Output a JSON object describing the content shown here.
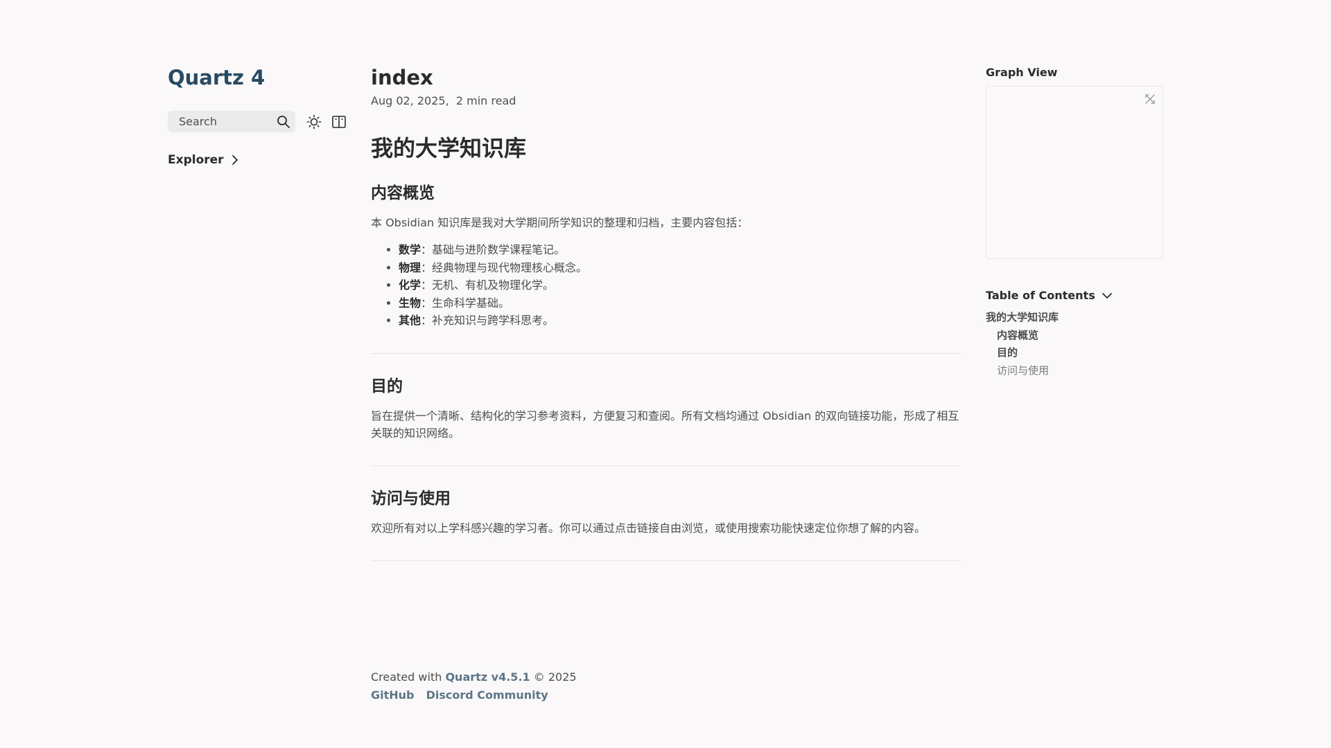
{
  "site": {
    "title": "Quartz 4"
  },
  "search": {
    "label": "Search"
  },
  "icons": {
    "search": "search-icon",
    "theme": "sun-icon",
    "reader": "book-icon",
    "explorer_chevron": "chevron-right-icon",
    "graph_expand": "expand-icon",
    "toc_chevron": "chevron-down-icon"
  },
  "explorer": {
    "label": "Explorer"
  },
  "page": {
    "title": "index",
    "date": "Aug 02, 2025",
    "read_time": "2 min read",
    "h1": "我的大学知识库",
    "sections": [
      {
        "heading": "内容概览",
        "intro": "本 Obsidian 知识库是我对大学期间所学知识的整理和归档，主要内容包括：",
        "items": [
          {
            "term": "数学",
            "desc": "：基础与进阶数学课程笔记。"
          },
          {
            "term": "物理",
            "desc": "：经典物理与现代物理核心概念。"
          },
          {
            "term": "化学",
            "desc": "：无机、有机及物理化学。"
          },
          {
            "term": "生物",
            "desc": "：生命科学基础。"
          },
          {
            "term": "其他",
            "desc": "：补充知识与跨学科思考。"
          }
        ]
      },
      {
        "heading": "目的",
        "text": "旨在提供一个清晰、结构化的学习参考资料，方便复习和查阅。所有文档均通过 Obsidian 的双向链接功能，形成了相互关联的知识网络。"
      },
      {
        "heading": "访问与使用",
        "text": "欢迎所有对以上学科感兴趣的学习者。你可以通过点击链接自由浏览，或使用搜索功能快速定位你想了解的内容。"
      }
    ]
  },
  "footer": {
    "prefix": "Created with",
    "link": "Quartz v4.5.1",
    "suffix": "© 2025",
    "links": [
      "GitHub",
      "Discord Community"
    ]
  },
  "graph": {
    "title": "Graph View"
  },
  "toc": {
    "title": "Table of Contents",
    "items": [
      "我的大学知识库",
      "内容概览",
      "目的",
      "访问与使用"
    ]
  },
  "colors": {
    "accent": "#284b63",
    "background": "#faf8f8"
  }
}
